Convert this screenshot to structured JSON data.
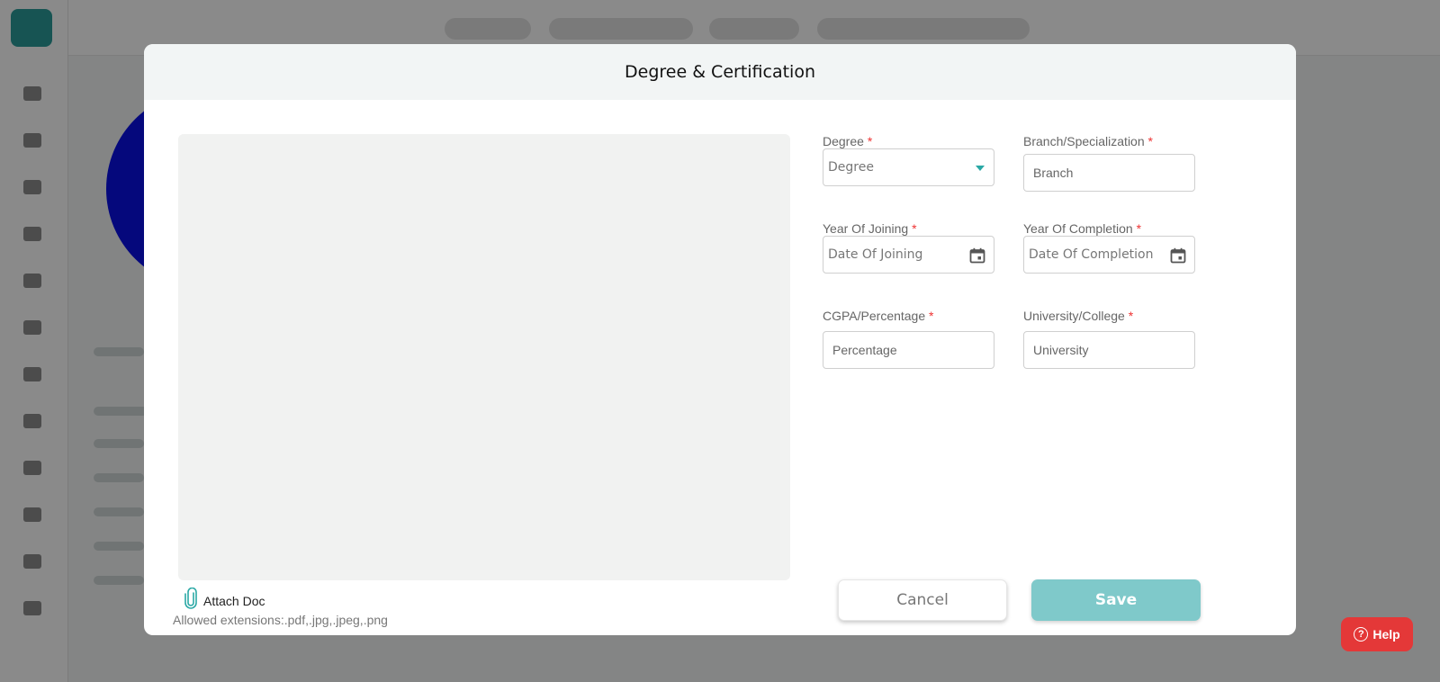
{
  "modal": {
    "title": "Degree & Certification",
    "attach_label": "Attach Doc",
    "allowed_extensions": "Allowed extensions:.pdf,.jpg,.jpeg,.png"
  },
  "form": {
    "degree": {
      "label": "Degree",
      "required": "*",
      "value": "Degree"
    },
    "branch": {
      "label": "Branch/Specialization",
      "required": "*",
      "placeholder": "Branch"
    },
    "year_joining": {
      "label": "Year Of Joining",
      "required": "*",
      "placeholder": "Date Of Joining"
    },
    "year_completion": {
      "label": "Year Of Completion",
      "required": "*",
      "placeholder": "Date Of Completion"
    },
    "cgpa": {
      "label": "CGPA/Percentage",
      "required": "*",
      "placeholder": "Percentage"
    },
    "university": {
      "label": "University/College",
      "required": "*",
      "placeholder": "University"
    }
  },
  "buttons": {
    "cancel": "Cancel",
    "save": "Save"
  },
  "help": {
    "label": "Help",
    "glyph": "?"
  },
  "colors": {
    "accent": "#2aa8a5",
    "save_bg": "#7fc9ca",
    "help_bg": "#e43838",
    "required": "#e33333"
  },
  "icons": {
    "attach": "paperclip-icon",
    "date": "calendar-icon",
    "select": "chevron-down-icon",
    "help": "question-circle-icon"
  }
}
